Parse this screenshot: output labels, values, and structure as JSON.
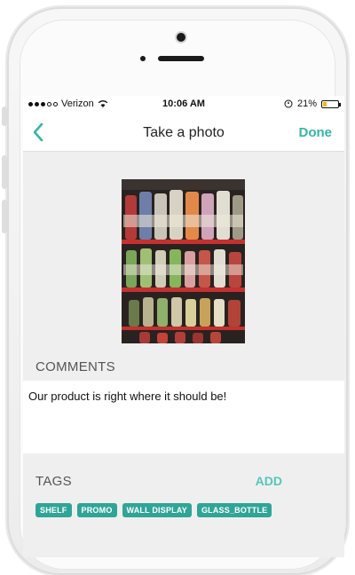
{
  "status_bar": {
    "carrier": "Verizon",
    "time": "10:06 AM",
    "battery": "21%"
  },
  "nav": {
    "title": "Take a photo",
    "done_label": "Done"
  },
  "comments": {
    "label": "COMMENTS",
    "text": "Our product is right where it should be!"
  },
  "tags": {
    "label": "TAGS",
    "add_label": "ADD",
    "items": [
      "SHELF",
      "PROMO",
      "WALL DISPLAY",
      "GLASS_BOTTLE"
    ]
  },
  "colors": {
    "accent": "#35b5a5",
    "tag_bg": "#2fa597",
    "screen_bg": "#efefef"
  },
  "icons": [
    "back-chevron-icon",
    "wifi-icon",
    "signal-dots-icon",
    "battery-icon",
    "location-icon"
  ]
}
